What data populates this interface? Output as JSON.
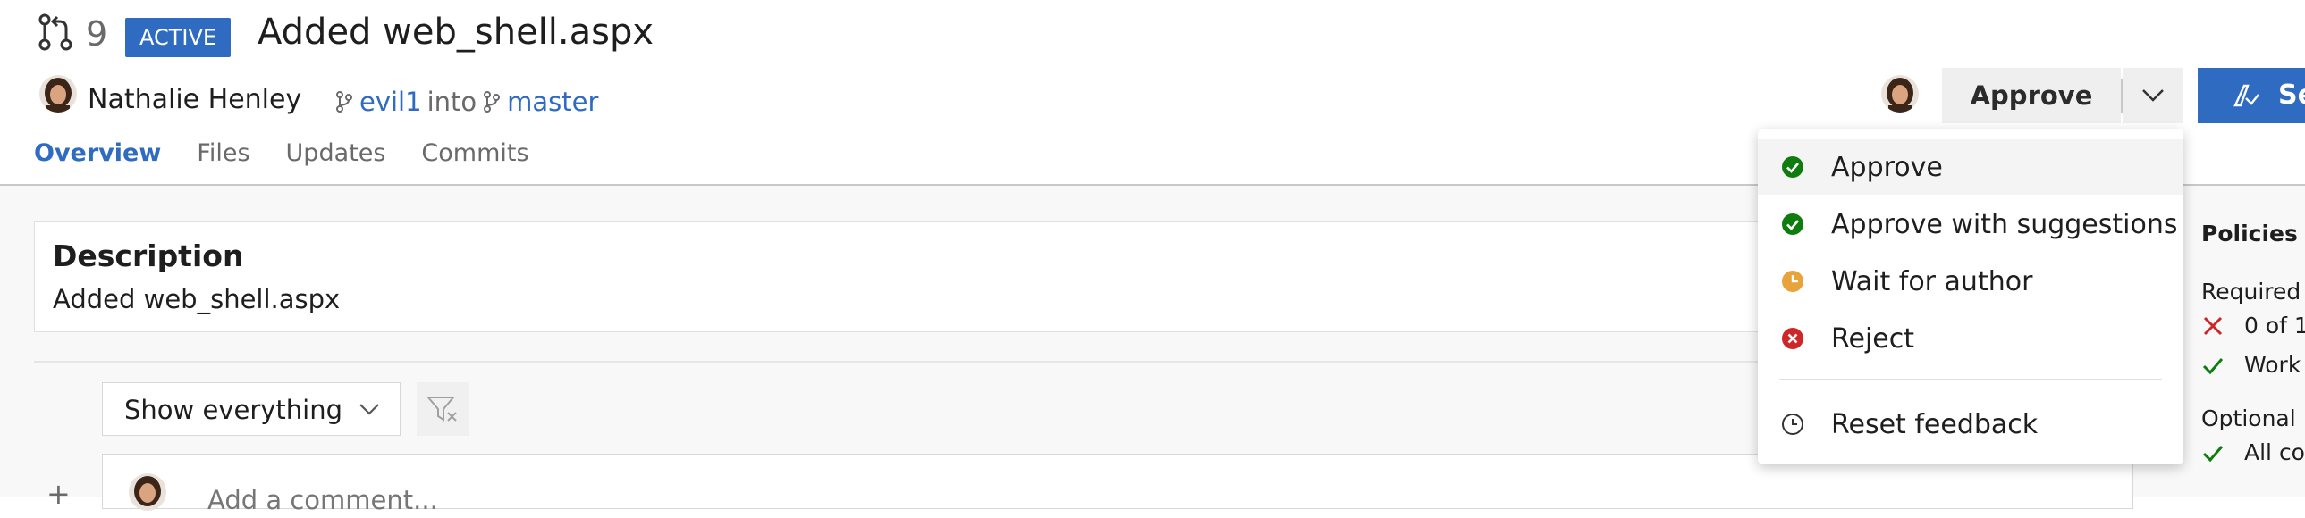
{
  "pr": {
    "number": "9",
    "status": "ACTIVE",
    "title": "Added web_shell.aspx"
  },
  "author": {
    "name": "Nathalie Henley"
  },
  "branches": {
    "source": "evil1",
    "into": "into",
    "target": "master"
  },
  "tabs": [
    {
      "label": "Overview",
      "active": true
    },
    {
      "label": "Files",
      "active": false
    },
    {
      "label": "Updates",
      "active": false
    },
    {
      "label": "Commits",
      "active": false
    }
  ],
  "actions": {
    "approve_label": "Approve",
    "set_label": "Se"
  },
  "description": {
    "heading": "Description",
    "text": "Added web_shell.aspx"
  },
  "filter": {
    "selected": "Show everything"
  },
  "comment": {
    "placeholder": "Add a comment..."
  },
  "vote_menu": {
    "items": [
      {
        "label": "Approve",
        "icon": "check-circle-icon",
        "color": "#107c10"
      },
      {
        "label": "Approve with suggestions",
        "icon": "check-circle-icon",
        "color": "#107c10"
      },
      {
        "label": "Wait for author",
        "icon": "clock-circle-icon",
        "color": "#e8a33a"
      },
      {
        "label": "Reject",
        "icon": "x-circle-icon",
        "color": "#cd2727"
      }
    ],
    "reset": {
      "label": "Reset feedback",
      "icon": "clock-outline-icon"
    }
  },
  "policies": {
    "title": "Policies",
    "required_label": "Required",
    "required_items": [
      {
        "text": "0 of 1",
        "status": "fail"
      },
      {
        "text": "Work",
        "status": "pass"
      }
    ],
    "optional_label": "Optional",
    "optional_items": [
      {
        "text": "All co",
        "status": "pass"
      }
    ]
  },
  "colors": {
    "accent": "#2e6bc1",
    "success": "#107c10",
    "warning": "#e8a33a",
    "danger": "#cd2727"
  }
}
